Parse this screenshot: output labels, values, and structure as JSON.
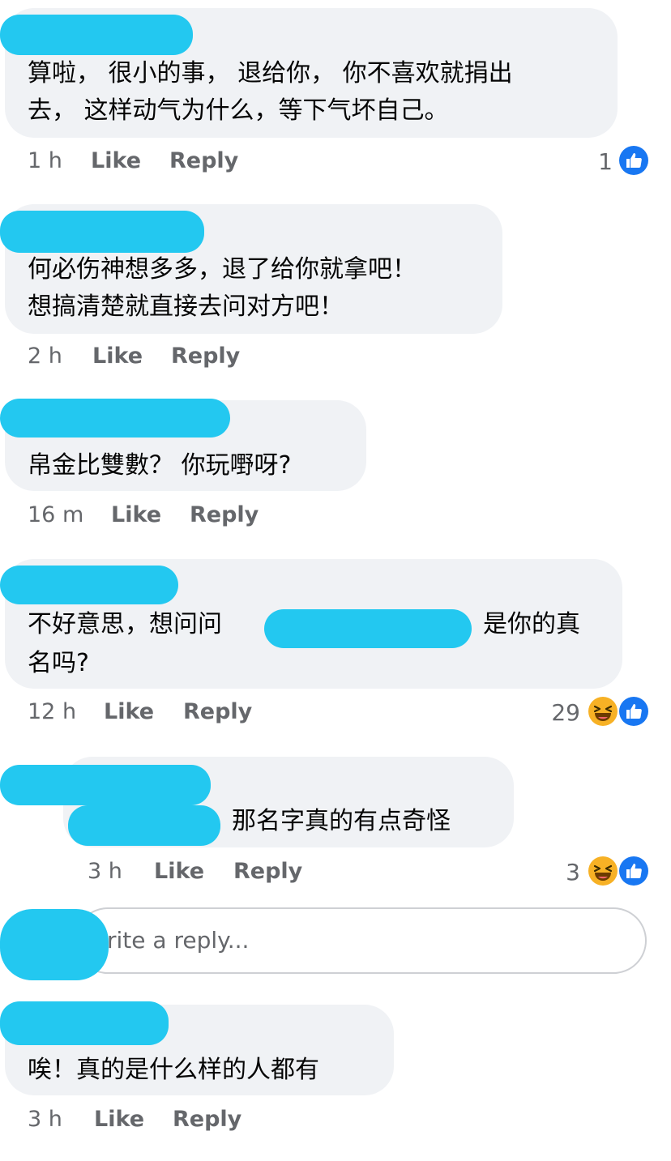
{
  "comments": [
    {
      "lines": [
        "算啦， 很小的事， 退给你， 你不喜欢就捐出",
        "去， 这样动气为什么，等下气坏自己。"
      ],
      "time": "1 h",
      "like": "Like",
      "reply": "Reply",
      "reaction_count": "1",
      "reactions": [
        "like-icon"
      ]
    },
    {
      "lines": [
        "何必伤神想多多，退了给你就拿吧！",
        "想搞清楚就直接去问对方吧！"
      ],
      "time": "2 h",
      "like": "Like",
      "reply": "Reply"
    },
    {
      "lines": [
        "帛金比雙數？ 你玩嘢呀?"
      ],
      "time": "16 m",
      "like": "Like",
      "reply": "Reply"
    },
    {
      "lines": [
        "不好意思，想问问",
        "是你的真",
        "名吗?"
      ],
      "time": "12 h",
      "like": "Like",
      "reply": "Reply",
      "reaction_count": "29",
      "reactions": [
        "haha-icon",
        "like-icon"
      ]
    },
    {
      "lines": [
        "那名字真的有点奇怪"
      ],
      "time": "3 h",
      "like": "Like",
      "reply": "Reply",
      "reaction_count": "3",
      "reactions": [
        "haha-icon",
        "like-icon"
      ]
    },
    {
      "lines": [
        "唉！真的是什么样的人都有"
      ],
      "time": "3 h",
      "like": "Like",
      "reply": "Reply"
    }
  ],
  "reply_input": {
    "placeholder": "rite a reply..."
  },
  "colors": {
    "bubble": "#f0f2f5",
    "redaction": "#23c8f0",
    "like_blue": "#1877f2",
    "haha_yellow": "#f7b125",
    "meta_gray": "#65676b"
  }
}
